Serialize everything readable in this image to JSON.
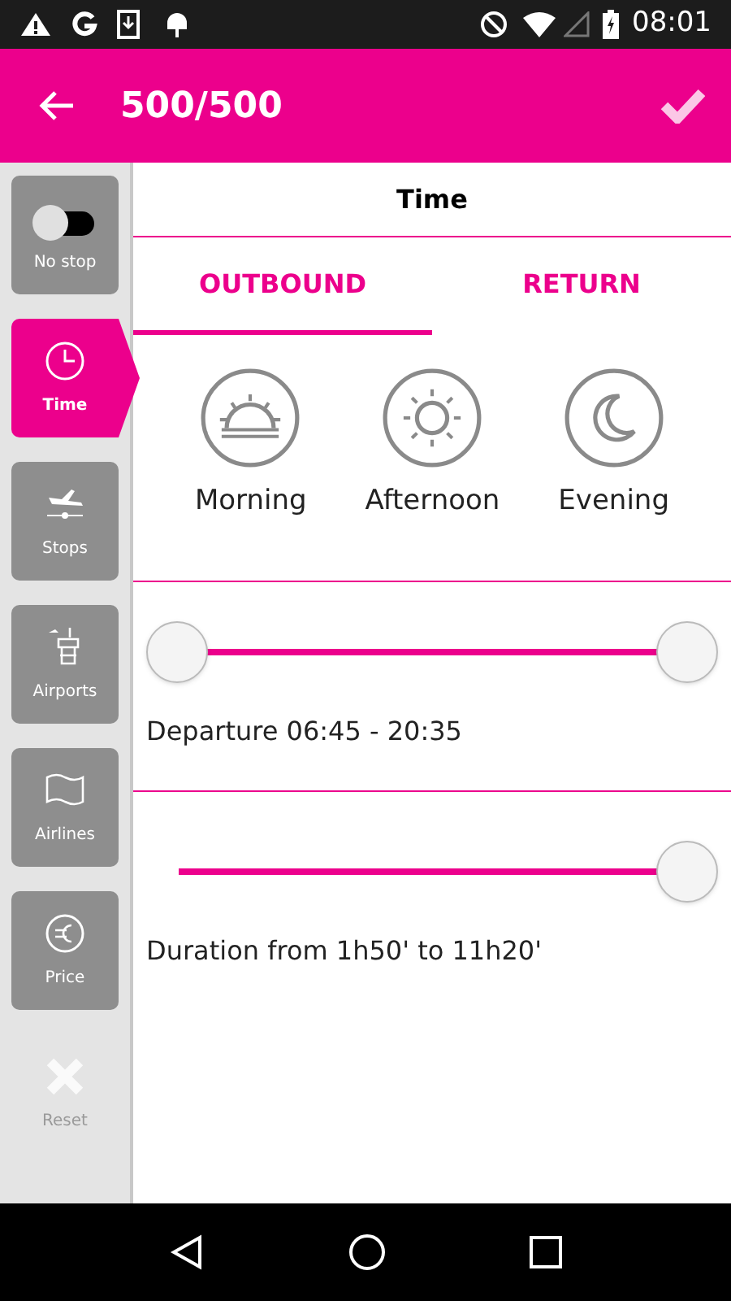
{
  "status_bar": {
    "time": "08:01"
  },
  "header": {
    "title": "500/500"
  },
  "sidebar": {
    "items": [
      {
        "kind": "toggle",
        "label": "No stop",
        "on": false,
        "selected": false
      },
      {
        "kind": "clock",
        "label": "Time",
        "selected": true
      },
      {
        "kind": "plane",
        "label": "Stops",
        "selected": false
      },
      {
        "kind": "tower",
        "label": "Airports",
        "selected": false
      },
      {
        "kind": "flag",
        "label": "Airlines",
        "selected": false
      },
      {
        "kind": "euro",
        "label": "Price",
        "selected": false
      },
      {
        "kind": "reset",
        "label": "Reset",
        "selected": false,
        "disabled": true
      }
    ]
  },
  "panel": {
    "title": "Time",
    "tabs": [
      {
        "label": "OUTBOUND",
        "selected": true
      },
      {
        "label": "RETURN",
        "selected": false
      }
    ],
    "periods": [
      {
        "kind": "sunrise",
        "label": "Morning"
      },
      {
        "kind": "sun",
        "label": "Afternoon"
      },
      {
        "kind": "moon",
        "label": "Evening"
      }
    ],
    "departure": {
      "thumbs": [
        {
          "level": 0
        },
        {
          "level": 1
        }
      ],
      "label": "Departure 06:45 - 20:35"
    },
    "duration": {
      "level": 1,
      "label": "Duration from 1h50' to 11h20'"
    }
  }
}
